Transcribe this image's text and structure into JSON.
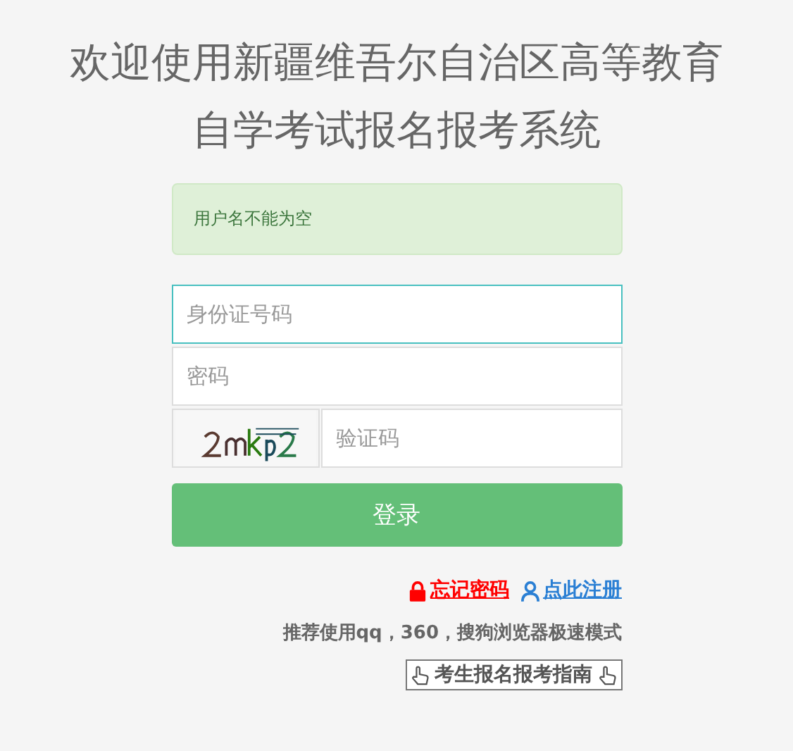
{
  "title": [
    "欢迎使用新疆维吾尔自治区高等教育",
    "自学考试报名报考系统"
  ],
  "alert": {
    "text": "用户名不能为空"
  },
  "fields": [
    {
      "placeholder": "身份证号码",
      "focused": true,
      "kind": "text"
    },
    {
      "placeholder": "密码",
      "focused": false,
      "kind": "password"
    },
    {
      "placeholder": "验证码",
      "focused": false,
      "kind": "captcha"
    }
  ],
  "login_button": "登录",
  "links": [
    {
      "label": "忘记密码",
      "kind": "lock",
      "color": "#ff0000"
    },
    {
      "label": "点此注册",
      "kind": "user",
      "color": "#2a7fd4"
    }
  ],
  "tip": "推荐使用qq，360，搜狗浏览器极速模式",
  "guide_button": "考生报名报考指南"
}
